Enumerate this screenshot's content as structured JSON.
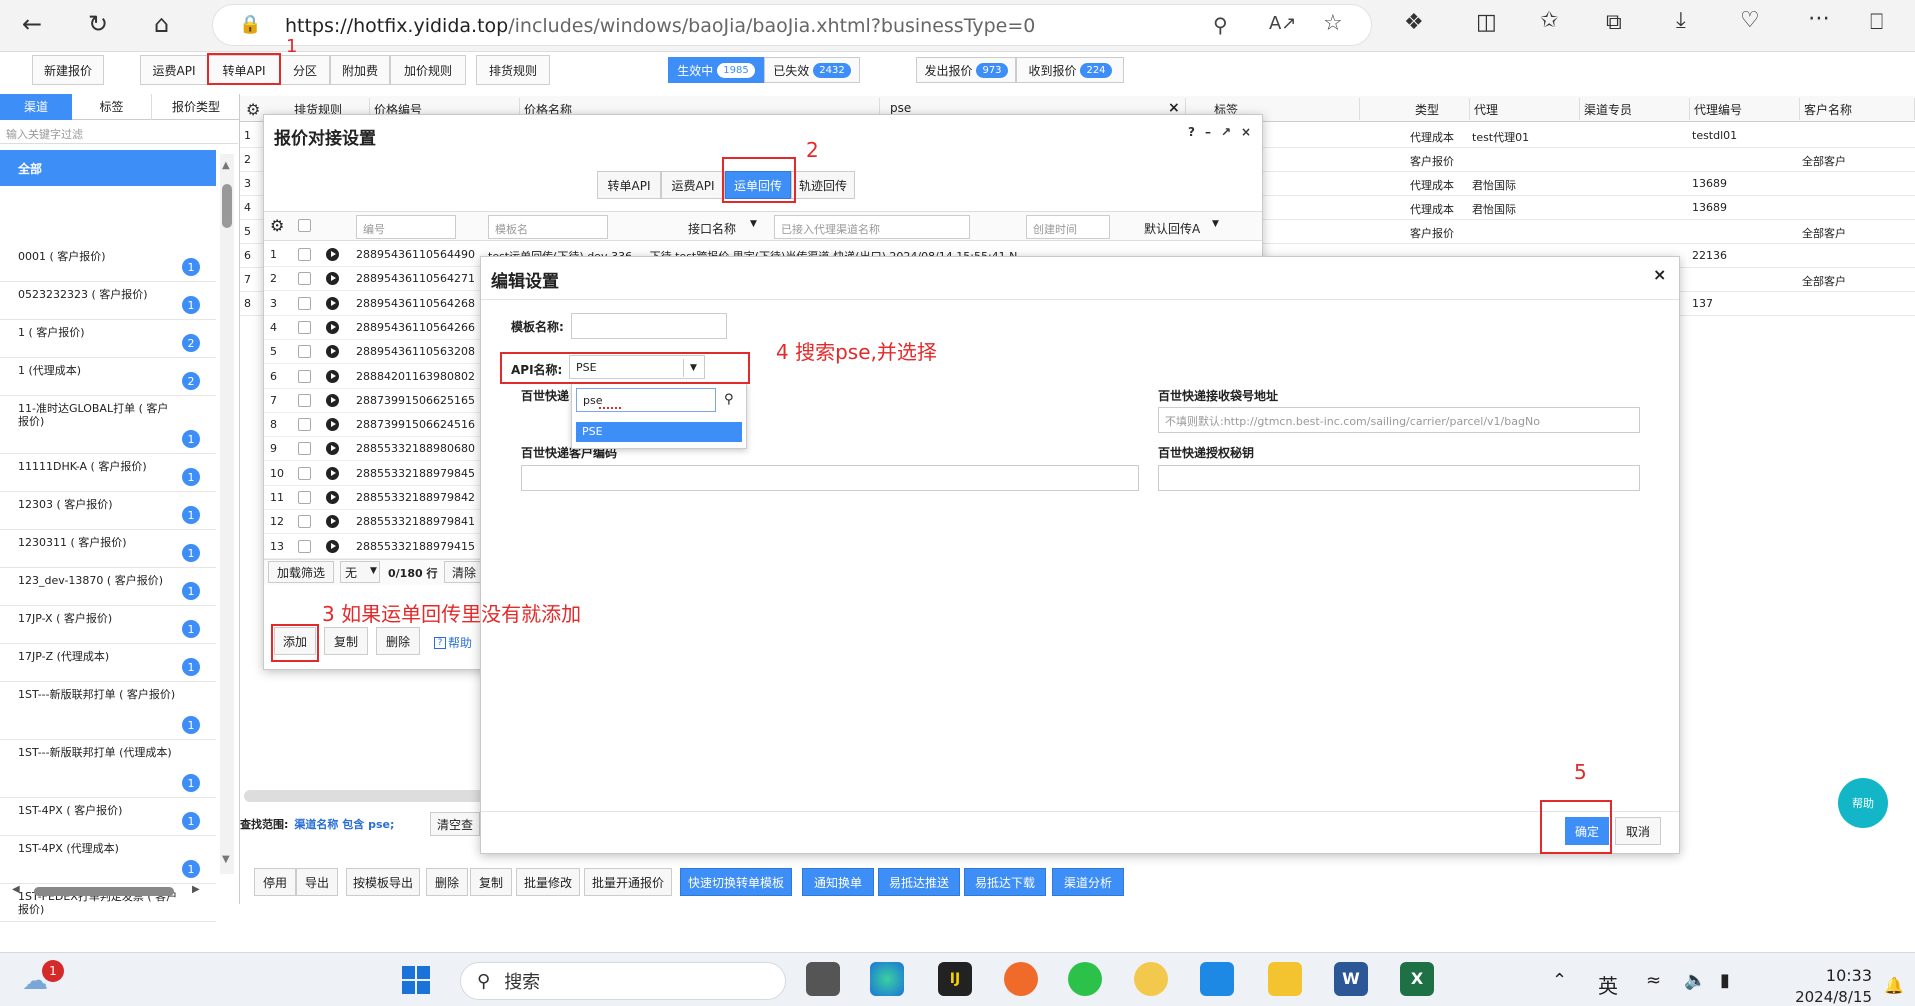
{
  "browser": {
    "url": "https://hotfix.yidida.top/includes/windows/baoJia/baoJia.xhtml?businessType=0",
    "url_host": "https://hotfix.yidida.top",
    "url_path": "/includes/windows/baoJia/baoJia.xhtml?businessType=0"
  },
  "toolbar": {
    "new_quote": "新建报价",
    "freight_api": "运费API",
    "transfer_api": "转单API",
    "partition": "分区",
    "surcharge": "附加费",
    "price_rule": "加价规则",
    "sort_rule": "排货规则",
    "active": "生效中",
    "active_count": "1985",
    "expired": "已失效",
    "expired_count": "2432",
    "sent": "发出报价",
    "sent_count": "973",
    "received": "收到报价",
    "received_count": "224"
  },
  "sidebar": {
    "tabs": [
      "渠道",
      "标签",
      "报价类型"
    ],
    "filter_placeholder": "输入关键字过滤",
    "all": "全部",
    "items": [
      {
        "label": "0001 ( 客户报价)",
        "count": "1"
      },
      {
        "label": "0523232323 ( 客户报价)",
        "count": "1"
      },
      {
        "label": "1 ( 客户报价)",
        "count": "2"
      },
      {
        "label": "1 (代理成本)",
        "count": "2"
      },
      {
        "label": "11-准时达GLOBAL打单 ( 客户报价)",
        "count": "1"
      },
      {
        "label": "11111DHK-A ( 客户报价)",
        "count": "1"
      },
      {
        "label": "12303 ( 客户报价)",
        "count": "1"
      },
      {
        "label": "1230311 ( 客户报价)",
        "count": "1"
      },
      {
        "label": "123_dev-13870 ( 客户报价)",
        "count": "1"
      },
      {
        "label": "17JP-X ( 客户报价)",
        "count": "1"
      },
      {
        "label": "17JP-Z (代理成本)",
        "count": "1"
      },
      {
        "label": "1ST---新版联邦打单 ( 客户报价)",
        "count": "1"
      },
      {
        "label": "1ST---新版联邦打单 (代理成本)",
        "count": "1"
      },
      {
        "label": "1ST-4PX ( 客户报价)",
        "count": "1"
      },
      {
        "label": "1ST-4PX (代理成本)",
        "count": "1"
      },
      {
        "label": "1ST-FEDEX打单判定发票 ( 客户报价)",
        "count": ""
      }
    ]
  },
  "grid": {
    "headers": [
      "排货规则",
      "价格编号",
      "价格名称",
      "pse",
      "标签",
      "类型",
      "代理",
      "渠道专员",
      "代理编号",
      "客户名称"
    ],
    "row_numbers": [
      "1",
      "2",
      "3",
      "4",
      "5",
      "6",
      "7",
      "8"
    ],
    "rows": [
      {
        "type": "代理成本",
        "agent": "test代理01",
        "agent_no": "testdl01",
        "client": ""
      },
      {
        "type": "客户报价",
        "agent": "",
        "agent_no": "",
        "client": "全部客户"
      },
      {
        "type": "代理成本",
        "agent": "君怡国际",
        "agent_no": "13689",
        "client": ""
      },
      {
        "type": "代理成本",
        "agent": "君怡国际",
        "agent_no": "13689",
        "client": ""
      },
      {
        "type": "客户报价",
        "agent": "",
        "agent_no": "",
        "client": "全部客户"
      },
      {
        "type": "",
        "agent": "",
        "agent_no": "22136",
        "client": ""
      },
      {
        "type": "",
        "agent": "",
        "agent_no": "",
        "client": "全部客户"
      },
      {
        "type": "",
        "agent": "",
        "agent_no": "137",
        "client": ""
      }
    ]
  },
  "search_scope": {
    "label": "查找范围:",
    "value": "渠道名称 包含 pse;",
    "clear": "清空查"
  },
  "bottom_buttons": {
    "disable": "停用",
    "export": "导出",
    "export_tpl": "按模板导出",
    "delete": "删除",
    "copy": "复制",
    "batch_edit": "批量修改",
    "batch_open": "批量开通报价",
    "quick_switch": "快速切换转单模板",
    "notify_change": "通知换单",
    "easy_push": "易抵达推送",
    "easy_download": "易抵达下载",
    "channel_analysis": "渠道分析"
  },
  "dialog1": {
    "title": "报价对接设置",
    "tabs": [
      "转单API",
      "运费API",
      "运单回传",
      "轨迹回传"
    ],
    "cols": {
      "no": "编号",
      "tpl_name": "模板名",
      "api_name": "接口名称",
      "channel": "已接入代理渠道名称",
      "created": "创建时间",
      "default": "默认回传A"
    },
    "rows": [
      "28895436110564490",
      "28895436110564271",
      "28895436110564268",
      "28895436110564266",
      "28895436110563208",
      "28884201163980802",
      "28873991506625165",
      "28873991506624516",
      "28855332188980680",
      "28855332188979845",
      "28855332188979842",
      "28855332188979841",
      "28855332188979415"
    ],
    "row_numbers": [
      "1",
      "2",
      "3",
      "4",
      "5",
      "6",
      "7",
      "8",
      "9",
      "10",
      "11",
      "12",
      "13"
    ],
    "first_row_extra": "test运单回传(下待) dev-336  ...  下待  test跨报价 思宇(下待)当传渠道-快递(出口)  2024/08/14 15:55:41  N",
    "footer": {
      "filter": "加载筛选",
      "none": "无",
      "count": "0/180 行",
      "clear": "清除"
    },
    "actions": {
      "add": "添加",
      "copy": "复制",
      "delete": "删除",
      "help": "帮助"
    }
  },
  "dialog2": {
    "title": "编辑设置",
    "tpl_label": "模板名称:",
    "api_label": "API名称:",
    "api_value": "PSE",
    "search_value": "pse",
    "option": "PSE",
    "f1_label": "百世快递",
    "f2_label": "百世快递接收袋号地址",
    "f2_placeholder": "不填则默认:http://gtmcn.best-inc.com/sailing/carrier/parcel/v1/bagNo",
    "f3_label": "百世快递客户编码",
    "f4_label": "百世快递授权秘钥",
    "ok": "确定",
    "cancel": "取消"
  },
  "annotations": {
    "a1": "1",
    "a2": "2",
    "a3": "3  如果运单回传里没有就添加",
    "a4": "4   搜索pse,并选择",
    "a5": "5"
  },
  "help_fab": "帮助",
  "taskbar": {
    "search": "搜索",
    "lang": "英",
    "time": "10:33",
    "date": "2024/8/15",
    "weather_badge": "1"
  }
}
